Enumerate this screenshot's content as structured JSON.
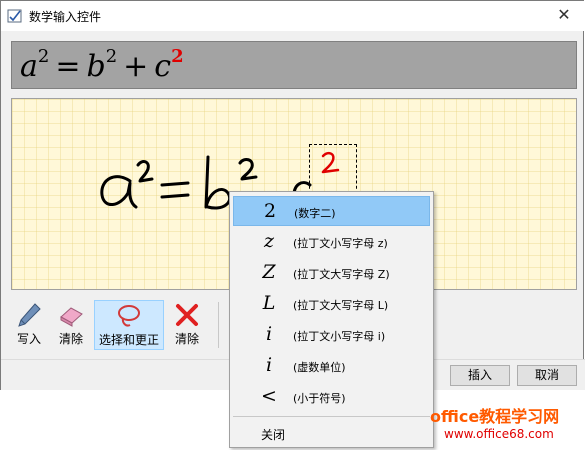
{
  "window": {
    "title": "数学输入控件",
    "close_glyph": "✕"
  },
  "preview": {
    "terms": [
      "a",
      "2",
      "=",
      "b",
      "2",
      "+",
      "c",
      "2"
    ],
    "highlight_color": "#e00000"
  },
  "ink": {
    "stroke_color": "#000000",
    "highlight_stroke_color": "#e00000"
  },
  "toolbar": {
    "tools": [
      {
        "label": "写入",
        "icon": "pen-icon",
        "selected": false
      },
      {
        "label": "清除",
        "icon": "eraser-icon",
        "selected": false
      },
      {
        "label": "选择和更正",
        "icon": "lasso-icon",
        "selected": true
      },
      {
        "label": "清除",
        "icon": "clear-x-icon",
        "selected": false
      }
    ]
  },
  "buttons": {
    "insert": "插入",
    "cancel": "取消"
  },
  "context_menu": {
    "items": [
      {
        "symbol": "2",
        "description": "(数字二)",
        "active": true
      },
      {
        "symbol": "z",
        "description": "(拉丁文小写字母 z)",
        "active": false
      },
      {
        "symbol": "Z",
        "description": "(拉丁文大写字母 Z)",
        "active": false
      },
      {
        "symbol": "L",
        "description": "(拉丁文大写字母 L)",
        "active": false
      },
      {
        "symbol": "i",
        "description": "(拉丁文小写字母 i)",
        "active": false
      },
      {
        "symbol": "i",
        "description": "(虚数单位)",
        "active": false
      },
      {
        "symbol": "<",
        "description": "(小于符号)",
        "active": false
      }
    ],
    "close_label": "关闭"
  },
  "watermark": {
    "main": "office教程学习网",
    "sub": "www.office68.com"
  }
}
